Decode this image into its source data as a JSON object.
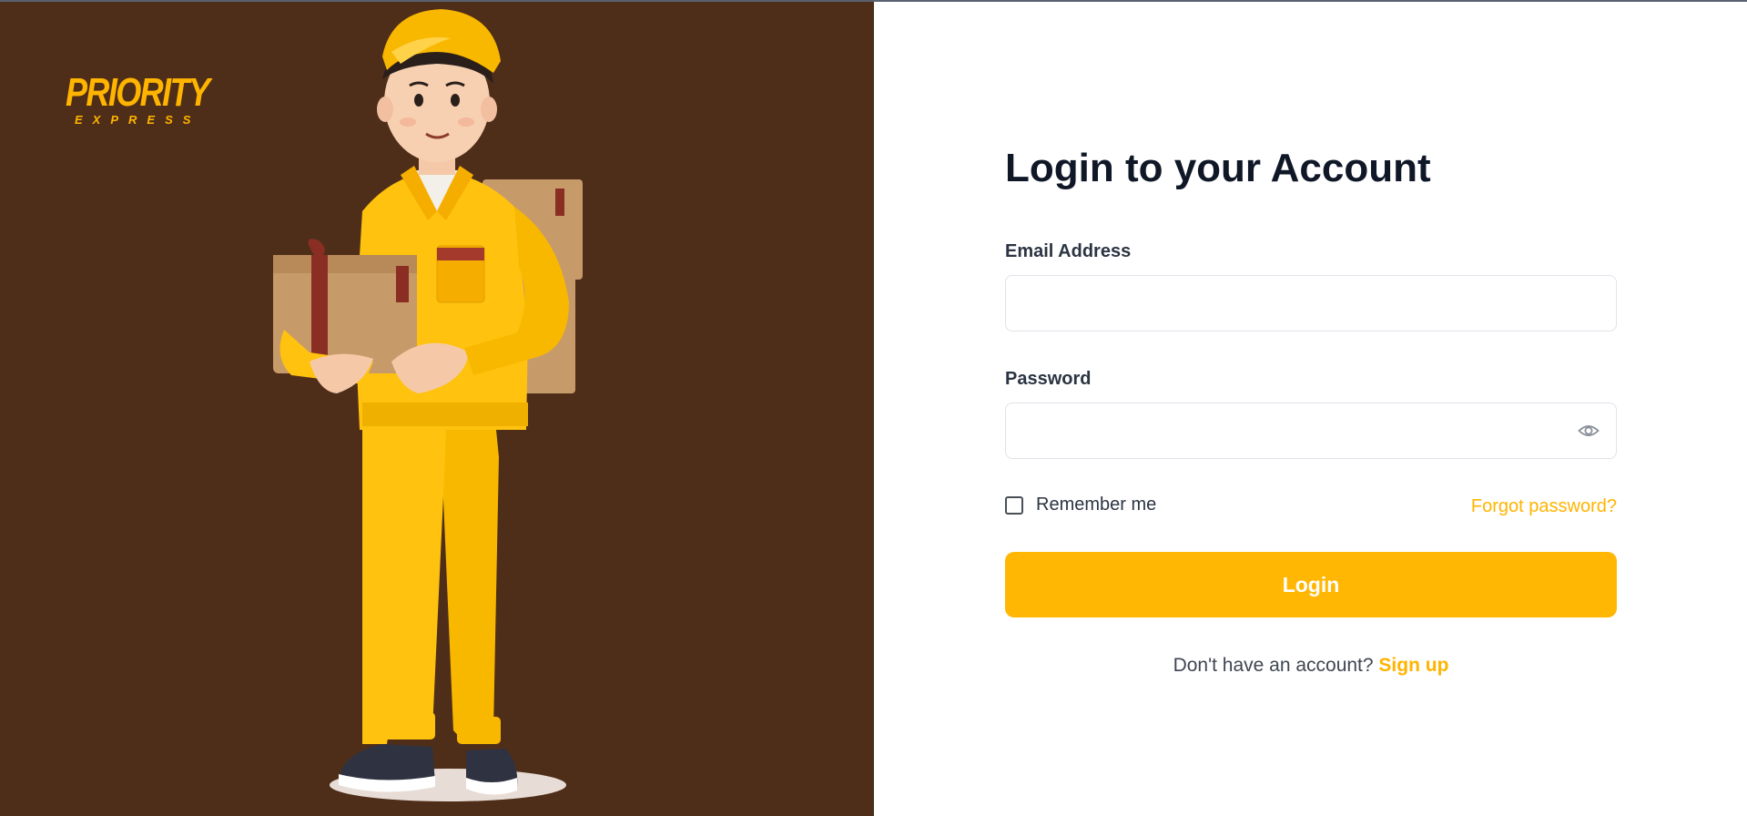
{
  "brand": {
    "logo_word": "PRIORITY",
    "logo_subword": "EXPRESS",
    "accent_color": "#ffb400",
    "panel_color": "#4f2e19"
  },
  "illustration": {
    "subject": "delivery-courier-holding-packages"
  },
  "form": {
    "title": "Login to your Account",
    "email_label": "Email Address",
    "email_value": "",
    "password_label": "Password",
    "password_value": "",
    "password_toggle_icon": "eye-icon",
    "remember_label": "Remember me",
    "remember_checked": false,
    "forgot_link": "Forgot password?",
    "submit_label": "Login",
    "signup_prompt": "Don't have an account?",
    "signup_link": "Sign up"
  }
}
